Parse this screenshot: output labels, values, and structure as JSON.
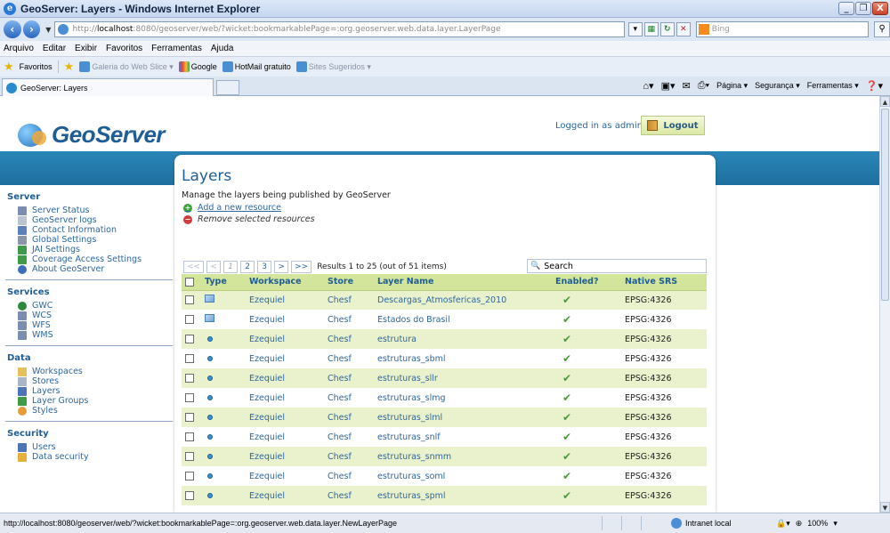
{
  "window": {
    "title": "GeoServer: Layers - Windows Internet Explorer",
    "btn_min": "_",
    "btn_max": "❐",
    "btn_close": "X"
  },
  "address": {
    "url_prefix": "http://",
    "url_host": "localhost",
    "url_rest": ":8080/geoserver/web/?wicket:bookmarkablePage=:org.geoserver.web.data.layer.LayerPage",
    "search_placeholder": "Bing"
  },
  "menu": [
    "Arquivo",
    "Editar",
    "Exibir",
    "Favoritos",
    "Ferramentas",
    "Ajuda"
  ],
  "favorites": {
    "label": "Favoritos",
    "items": [
      {
        "label": "Galeria do Web Slice ▾",
        "dim": true
      },
      {
        "label": "Google",
        "dim": false
      },
      {
        "label": "HotMail gratuito",
        "dim": false
      },
      {
        "label": "Sites Sugeridos ▾",
        "dim": true
      }
    ]
  },
  "tab": {
    "label": "GeoServer: Layers"
  },
  "commandbar": {
    "page": "Página ▾",
    "security": "Segurança ▾",
    "tools": "Ferramentas ▾"
  },
  "header": {
    "logo_text": "GeoServer",
    "logged_in": "Logged in as admin.",
    "logout": "Logout"
  },
  "sidebar": {
    "sections": [
      {
        "title": "Server",
        "items": [
          {
            "label": "Server Status",
            "color": "#7a8fb0"
          },
          {
            "label": "GeoServer logs",
            "color": "#b9c3d1"
          },
          {
            "label": "Contact Information",
            "color": "#5d7fb7"
          },
          {
            "label": "Global Settings",
            "color": "#8a97a8"
          },
          {
            "label": "JAI Settings",
            "color": "#3f9a4a"
          },
          {
            "label": "Coverage Access Settings",
            "color": "#3f9a4a"
          },
          {
            "label": "About GeoServer",
            "color": "#3d6fb8"
          }
        ]
      },
      {
        "title": "Services",
        "items": [
          {
            "label": "GWC",
            "color": "#2e8a3a"
          },
          {
            "label": "WCS",
            "color": "#7a8fb0"
          },
          {
            "label": "WFS",
            "color": "#7a8fb0"
          },
          {
            "label": "WMS",
            "color": "#7a8fb0"
          }
        ]
      },
      {
        "title": "Data",
        "items": [
          {
            "label": "Workspaces",
            "color": "#e8c05a"
          },
          {
            "label": "Stores",
            "color": "#a9b6c8"
          },
          {
            "label": "Layers",
            "color": "#4d74b6"
          },
          {
            "label": "Layer Groups",
            "color": "#3f9a4a"
          },
          {
            "label": "Styles",
            "color": "#e59c3a"
          }
        ]
      },
      {
        "title": "Security",
        "items": [
          {
            "label": "Users",
            "color": "#4d74b6"
          },
          {
            "label": "Data security",
            "color": "#e5b13a"
          }
        ]
      }
    ]
  },
  "main": {
    "title": "Layers",
    "description": "Manage the layers being published by GeoServer",
    "add_link": "Add a new resource",
    "remove_link": "Remove selected resources",
    "pager": {
      "first": "<<",
      "prev": "<",
      "current": "1",
      "p2": "2",
      "p3": "3",
      "next": ">",
      "last": ">>",
      "results": "Results 1 to 25 (out of 51 items)"
    },
    "search_label": "Search",
    "columns": [
      "Type",
      "Workspace",
      "Store",
      "Layer Name",
      "Enabled?",
      "Native SRS"
    ],
    "rows": [
      {
        "type": "raster",
        "workspace": "Ezequiel",
        "store": "Chesf",
        "layer": "Descargas_Atmosfericas_2010",
        "enabled": "✔",
        "srs": "EPSG:4326"
      },
      {
        "type": "raster",
        "workspace": "Ezequiel",
        "store": "Chesf",
        "layer": "Estados do Brasil",
        "enabled": "✔",
        "srs": "EPSG:4326"
      },
      {
        "type": "vector",
        "workspace": "Ezequiel",
        "store": "Chesf",
        "layer": "estrutura",
        "enabled": "✔",
        "srs": "EPSG:4326"
      },
      {
        "type": "vector",
        "workspace": "Ezequiel",
        "store": "Chesf",
        "layer": "estruturas_sbml",
        "enabled": "✔",
        "srs": "EPSG:4326"
      },
      {
        "type": "vector",
        "workspace": "Ezequiel",
        "store": "Chesf",
        "layer": "estruturas_sllr",
        "enabled": "✔",
        "srs": "EPSG:4326"
      },
      {
        "type": "vector",
        "workspace": "Ezequiel",
        "store": "Chesf",
        "layer": "estruturas_slmg",
        "enabled": "✔",
        "srs": "EPSG:4326"
      },
      {
        "type": "vector",
        "workspace": "Ezequiel",
        "store": "Chesf",
        "layer": "estruturas_slml",
        "enabled": "✔",
        "srs": "EPSG:4326"
      },
      {
        "type": "vector",
        "workspace": "Ezequiel",
        "store": "Chesf",
        "layer": "estruturas_snlf",
        "enabled": "✔",
        "srs": "EPSG:4326"
      },
      {
        "type": "vector",
        "workspace": "Ezequiel",
        "store": "Chesf",
        "layer": "estruturas_snmm",
        "enabled": "✔",
        "srs": "EPSG:4326"
      },
      {
        "type": "vector",
        "workspace": "Ezequiel",
        "store": "Chesf",
        "layer": "estruturas_soml",
        "enabled": "✔",
        "srs": "EPSG:4326"
      },
      {
        "type": "vector",
        "workspace": "Ezequiel",
        "store": "Chesf",
        "layer": "estruturas_spml",
        "enabled": "✔",
        "srs": "EPSG:4326"
      }
    ]
  },
  "status": {
    "url": "http://localhost:8080/geoserver/web/?wicket:bookmarkablePage=:org.geoserver.web.data.layer.NewLayerPage",
    "zone": "Intranet local",
    "zoom": "100%"
  }
}
